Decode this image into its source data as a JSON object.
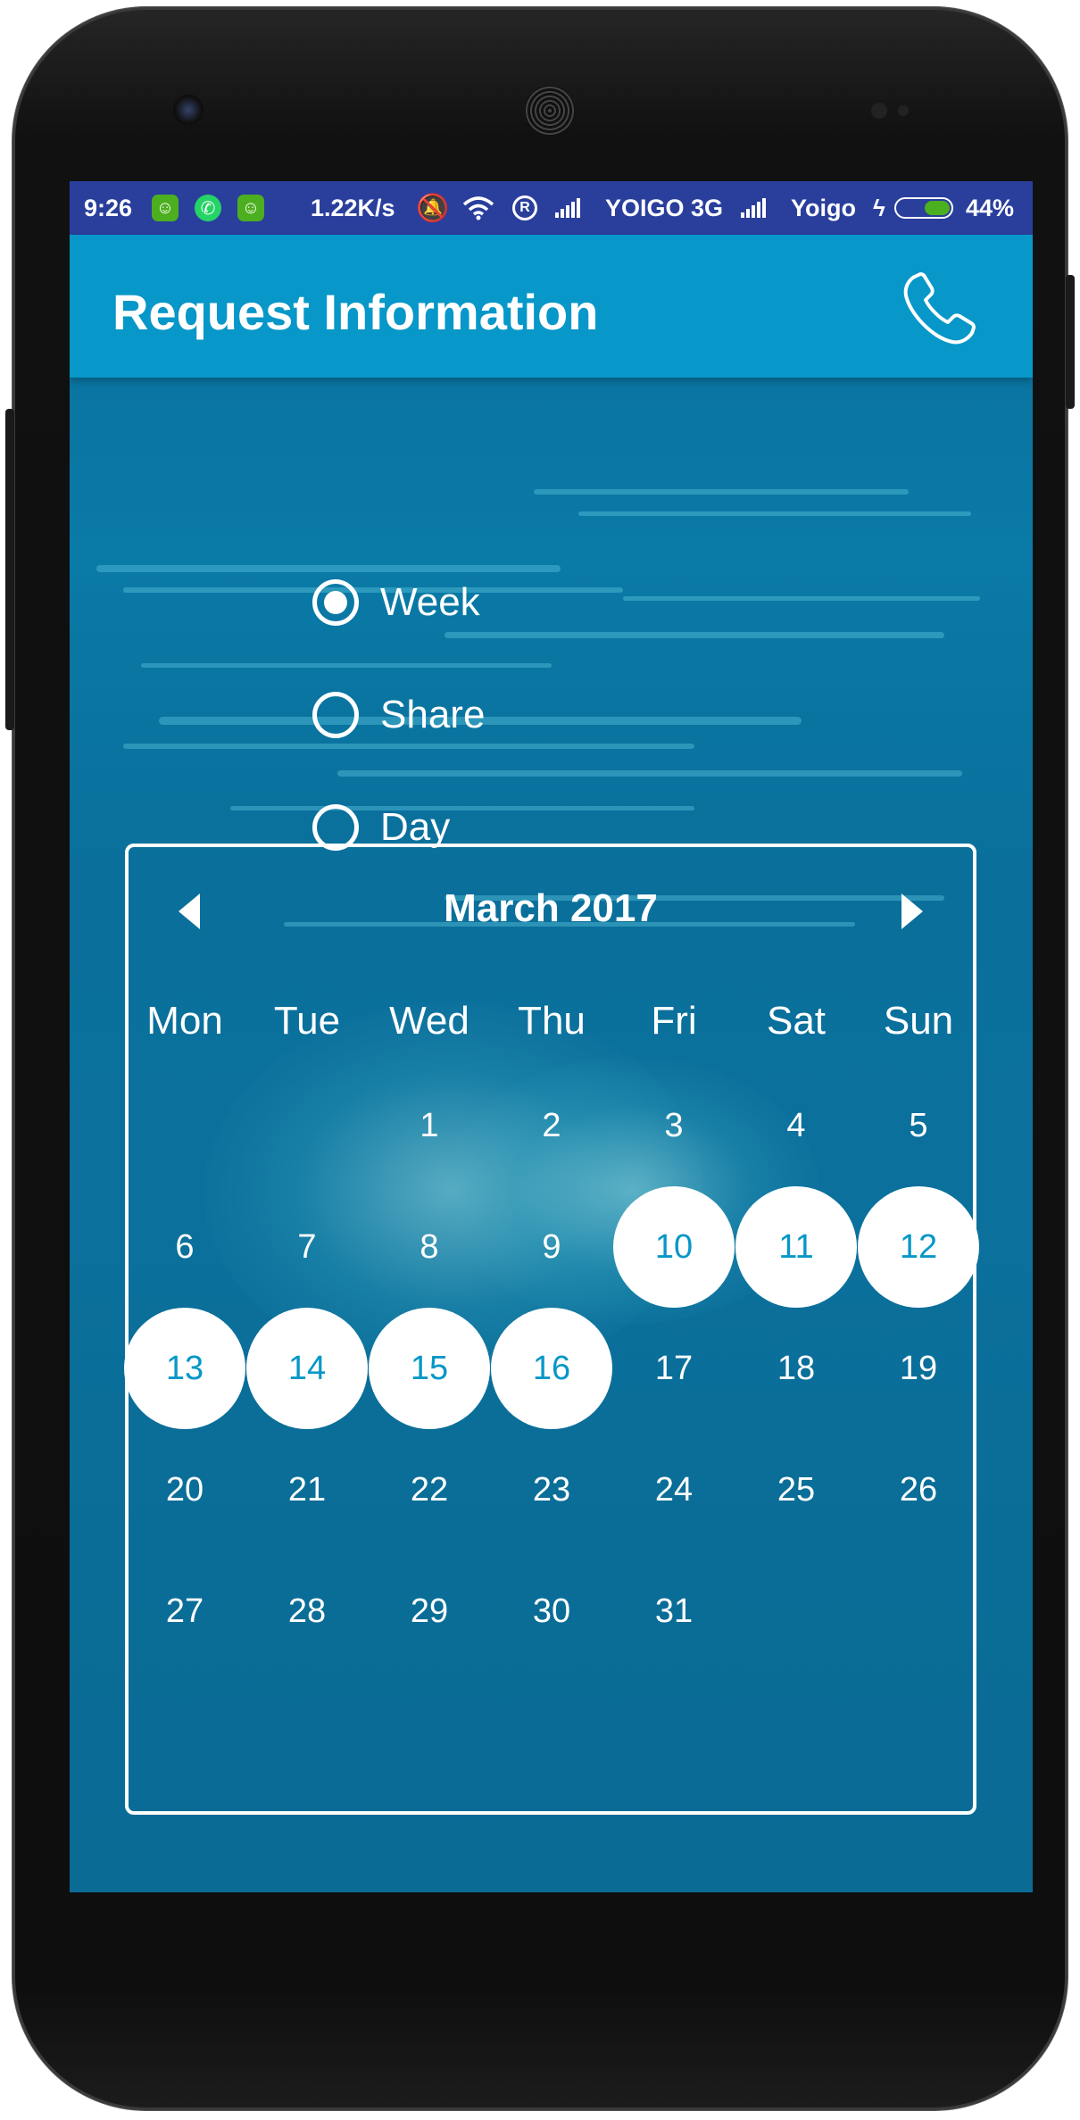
{
  "status_bar": {
    "time": "9:26",
    "speed": "1.22K/s",
    "carrier1": "YOIGO 3G",
    "carrier2": "Yoigo",
    "battery": "44%",
    "battery_level": 0.44,
    "colors": {
      "background": "#2a3f9c",
      "battery_fill": "#4caf1f"
    }
  },
  "app_bar": {
    "title": "Request Information",
    "action_icon": "phone-icon",
    "color": "#0797c8"
  },
  "options": [
    {
      "label": "Week",
      "selected": true
    },
    {
      "label": "Share",
      "selected": false
    },
    {
      "label": "Day",
      "selected": false
    }
  ],
  "calendar": {
    "month_label": "March 2017",
    "prev_icon": "chevron-left-icon",
    "next_icon": "chevron-right-icon",
    "weekdays": [
      "Mon",
      "Tue",
      "Wed",
      "Thu",
      "Fri",
      "Sat",
      "Sun"
    ],
    "days": [
      "1",
      "2",
      "3",
      "4",
      "5",
      "6",
      "7",
      "8",
      "9",
      "10",
      "11",
      "12",
      "13",
      "14",
      "15",
      "16",
      "17",
      "18",
      "19",
      "20",
      "21",
      "22",
      "23",
      "24",
      "25",
      "26",
      "27",
      "28",
      "29",
      "30",
      "31"
    ],
    "selected_days": [
      "10",
      "11",
      "12",
      "13",
      "14",
      "15",
      "16"
    ],
    "colors": {
      "selected_bg": "#ffffff",
      "selected_text": "#0797c8"
    }
  }
}
